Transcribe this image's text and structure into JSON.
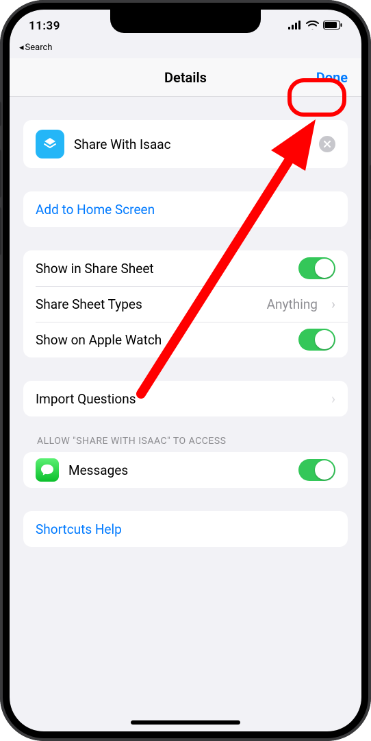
{
  "status": {
    "time": "11:39",
    "back_label": "Search"
  },
  "nav": {
    "title": "Details",
    "done": "Done"
  },
  "shortcut": {
    "name": "Share With Isaac"
  },
  "actions": {
    "add_home": "Add to Home Screen"
  },
  "share": {
    "show_sheet": "Show in Share Sheet",
    "types_label": "Share Sheet Types",
    "types_value": "Anything",
    "show_watch": "Show on Apple Watch"
  },
  "import": {
    "label": "Import Questions"
  },
  "access": {
    "header": "ALLOW \"SHARE WITH ISAAC\" TO ACCESS",
    "messages": "Messages"
  },
  "help": {
    "label": "Shortcuts Help"
  }
}
